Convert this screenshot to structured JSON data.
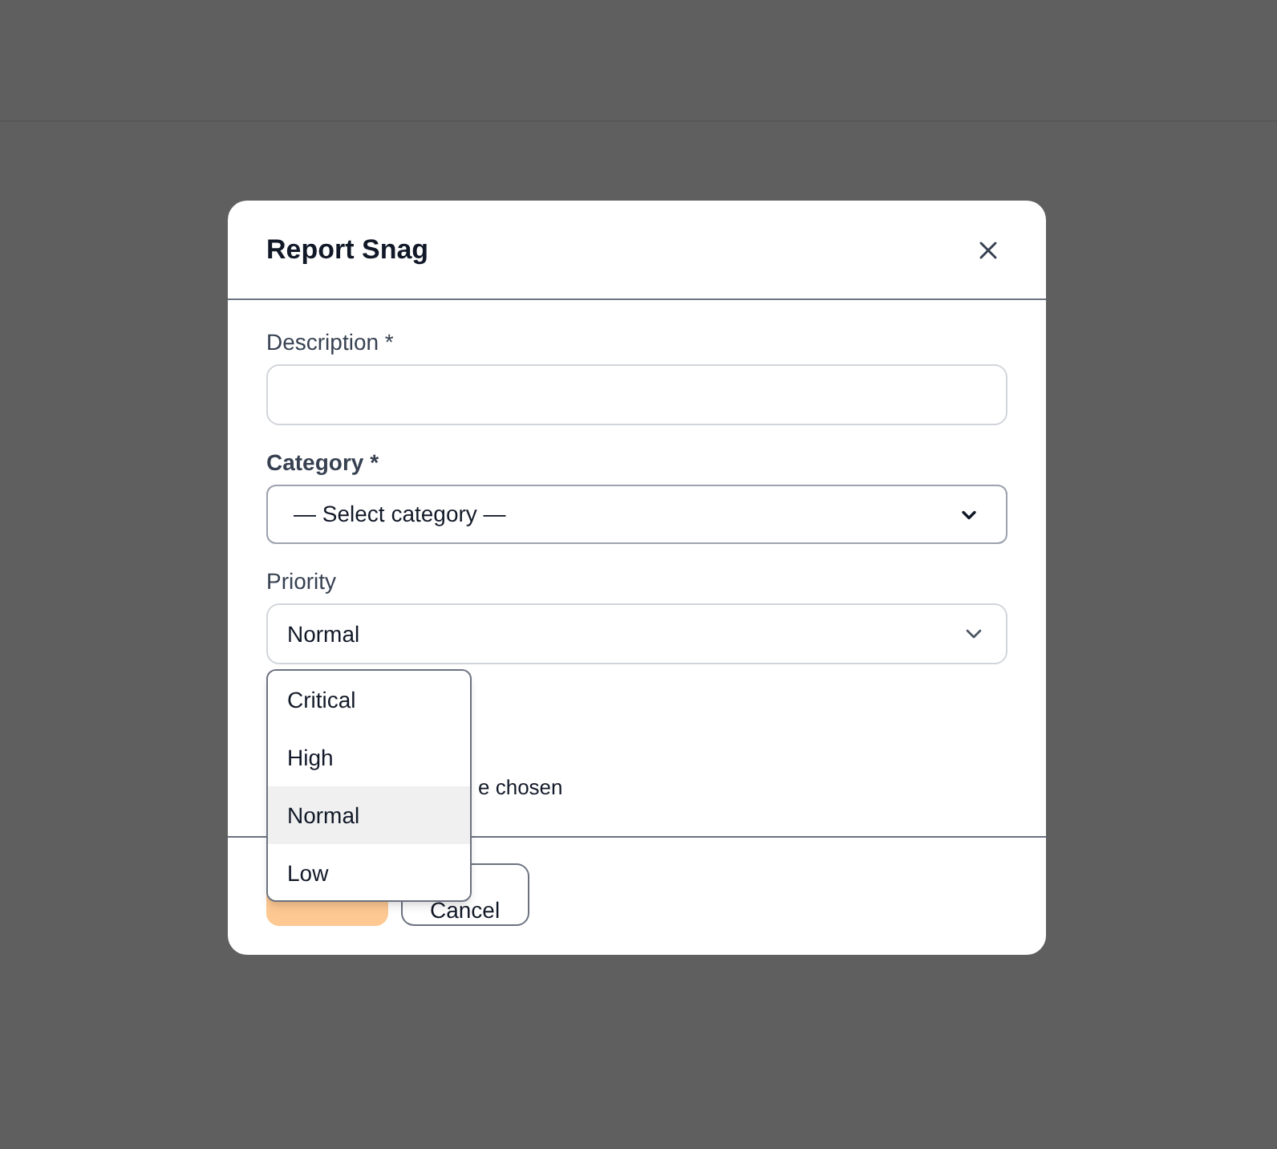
{
  "dialog": {
    "title": "Report Snag",
    "fields": [
      {
        "kind": "text",
        "label": "Description *"
      },
      {
        "kind": "select",
        "label": "Category *",
        "value": "— Select category —"
      },
      {
        "kind": "custom-select",
        "label": "Priority",
        "value": "Normal"
      }
    ],
    "file_note": "e chosen",
    "priority_menu": [
      {
        "label": "Critical",
        "selected": false
      },
      {
        "label": "High",
        "selected": false
      },
      {
        "label": "Normal",
        "selected": true
      },
      {
        "label": "Low",
        "selected": false
      }
    ],
    "buttons": [
      {
        "kind": "primary"
      },
      {
        "kind": "secondary",
        "label": "Cancel"
      }
    ]
  }
}
